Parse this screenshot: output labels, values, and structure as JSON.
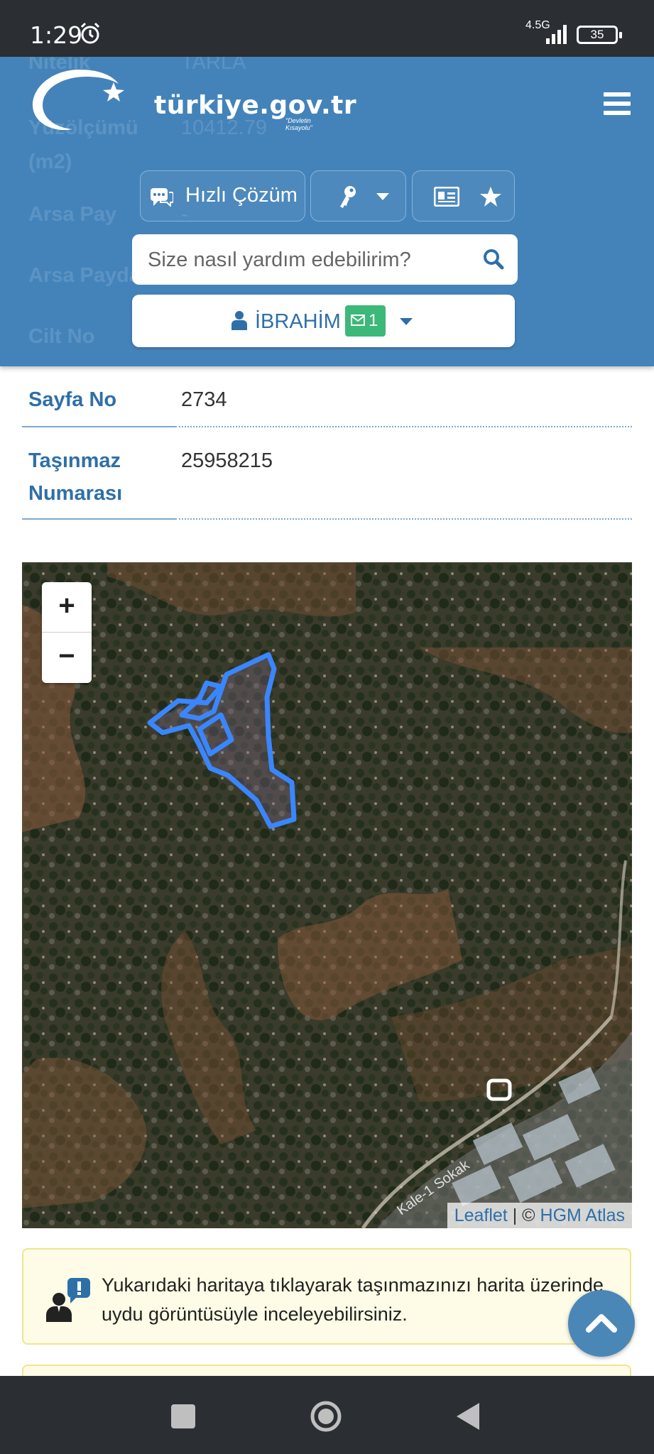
{
  "status_bar": {
    "time": "1:29",
    "network": "4.5G",
    "battery": "35"
  },
  "header": {
    "logo_text": "türkiye.gov.tr",
    "logo_tagline": "\"Devletin Kısayolu\"",
    "quick_solution_label": "Hızlı Çözüm",
    "search_placeholder": "Size nasıl yardım edebilirim?",
    "user_name": "İBRAHİM",
    "message_count": "1"
  },
  "ghost_rows": [
    {
      "label": "Nitelik",
      "value": "TARLA"
    },
    {
      "label": "Yüzölçümü (m2)",
      "value": "10412.79"
    },
    {
      "label": "Arsa Pay",
      "value": "-"
    },
    {
      "label": "Arsa Payda",
      "value": "-"
    },
    {
      "label": "Cilt No",
      "value": ""
    }
  ],
  "property": {
    "rows": [
      {
        "label": "Sayfa No",
        "value": "2734"
      },
      {
        "label": "Taşınmaz Numarası",
        "value": "25958215"
      }
    ]
  },
  "map": {
    "zoom_in": "+",
    "zoom_out": "−",
    "attribution_lib": "Leaflet",
    "attribution_sep": " | © ",
    "attribution_source": "HGM Atlas",
    "street_label": "Kale-1 Sokak"
  },
  "info": {
    "text": "Yukarıdaki haritaya tıklayarak taşınmazınızı harita üzerinde uydu görüntüsüyle inceleyebilirsiniz."
  },
  "colors": {
    "brand_blue": "#3e7fb8",
    "parcel_outline": "#3a86ff",
    "badge_green": "#3cb878"
  }
}
